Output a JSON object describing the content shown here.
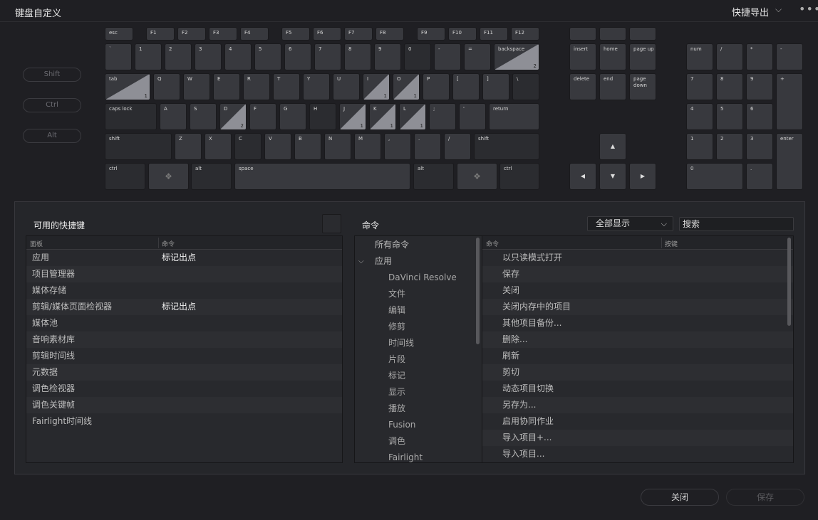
{
  "title": "键盘自定义",
  "export_label": "快捷导出",
  "export_chevron": "⌵",
  "more_menu": "•••",
  "modifiers": {
    "shift": "Shift",
    "ctrl": "Ctrl",
    "alt": "Alt"
  },
  "keys": {
    "esc": "esc",
    "f1": "F1",
    "f2": "F2",
    "f3": "F3",
    "f4": "F4",
    "f5": "F5",
    "f6": "F6",
    "f7": "F7",
    "f8": "F8",
    "f9": "F9",
    "f10": "F10",
    "f11": "F11",
    "f12": "F12",
    "grave": "`",
    "n1": "1",
    "n2": "2",
    "n3": "3",
    "n4": "4",
    "n5": "5",
    "n6": "6",
    "n7": "7",
    "n8": "8",
    "n9": "9",
    "n0": "0",
    "minus": "-",
    "equal": "=",
    "backspace": "backspace",
    "backspace_count": "2",
    "tab": "tab",
    "tab_count": "1",
    "q": "Q",
    "w": "W",
    "e": "E",
    "r": "R",
    "t": "T",
    "y": "Y",
    "u": "U",
    "i": "I",
    "i_count": "1",
    "o": "O",
    "o_count": "1",
    "p": "P",
    "lbr": "[",
    "rbr": "]",
    "bslash": "\\",
    "caps": "caps lock",
    "a": "A",
    "s": "S",
    "d": "D",
    "d_count": "2",
    "f": "F",
    "g": "G",
    "h": "H",
    "j": "J",
    "j_count": "1",
    "k": "K",
    "k_count": "1",
    "l": "L",
    "l_count": "1",
    "semi": ";",
    "quote": "'",
    "ret": "return",
    "lshift": "shift",
    "z": "Z",
    "x": "X",
    "c": "C",
    "v": "V",
    "b": "B",
    "n": "N",
    "m": "M",
    "comma": ",",
    "period": ".",
    "slash": "/",
    "rshift": "shift",
    "lctrl": "ctrl",
    "alt": "alt",
    "space": "space",
    "ralt": "alt",
    "rctrl": "ctrl",
    "insert": "insert",
    "home": "home",
    "pgup": "page up",
    "delete": "delete",
    "end": "end",
    "pgdn": "page down",
    "up": "▲",
    "left": "◀",
    "down": "▼",
    "right": "▶",
    "num": "num",
    "kpdiv": "/",
    "kpmul": "*",
    "kpminus": "-",
    "kp7": "7",
    "kp8": "8",
    "kp9": "9",
    "kpplus": "+",
    "kp4": "4",
    "kp5": "5",
    "kp6": "6",
    "kp1": "1",
    "kp2": "2",
    "kp3": "3",
    "enter": "enter",
    "kp0": "0",
    "kpdot": "."
  },
  "keymap": {
    "title": "可用的快捷键",
    "col1": "面板",
    "col2": "命令",
    "rows": [
      {
        "panel": "应用",
        "cmd": "标记出点"
      },
      {
        "panel": "项目管理器",
        "cmd": ""
      },
      {
        "panel": "媒体存储",
        "cmd": ""
      },
      {
        "panel": "剪辑/媒体页面检视器",
        "cmd": "标记出点"
      },
      {
        "panel": "媒体池",
        "cmd": ""
      },
      {
        "panel": "音响素材库",
        "cmd": ""
      },
      {
        "panel": "剪辑时间线",
        "cmd": ""
      },
      {
        "panel": "元数据",
        "cmd": ""
      },
      {
        "panel": "调色检视器",
        "cmd": ""
      },
      {
        "panel": "调色关键帧",
        "cmd": ""
      },
      {
        "panel": "Fairlight时间线",
        "cmd": ""
      }
    ]
  },
  "commands": {
    "title": "命令",
    "filter": "全部显示",
    "search_placeholder": "搜索",
    "tree_expander": "⌵",
    "tree": [
      {
        "label": "所有命令",
        "level": 0
      },
      {
        "label": "应用",
        "level": 0
      },
      {
        "label": "DaVinci Resolve",
        "level": 1
      },
      {
        "label": "文件",
        "level": 1
      },
      {
        "label": "编辑",
        "level": 1
      },
      {
        "label": "修剪",
        "level": 1
      },
      {
        "label": "时间线",
        "level": 1
      },
      {
        "label": "片段",
        "level": 1
      },
      {
        "label": "标记",
        "level": 1
      },
      {
        "label": "显示",
        "level": 1
      },
      {
        "label": "播放",
        "level": 1
      },
      {
        "label": "Fusion",
        "level": 1
      },
      {
        "label": "调色",
        "level": 1
      },
      {
        "label": "Fairlight",
        "level": 1
      }
    ],
    "col1": "命令",
    "col2": "按键",
    "list": [
      "以只读模式打开",
      "保存",
      "关闭",
      "关闭内存中的项目",
      "其他项目备份...",
      "删除...",
      "刷新",
      "剪切",
      "动态项目切换",
      "另存为...",
      "启用协同作业",
      "导入项目+...",
      "导入项目..."
    ]
  },
  "buttons": {
    "close": "关闭",
    "save": "保存"
  }
}
